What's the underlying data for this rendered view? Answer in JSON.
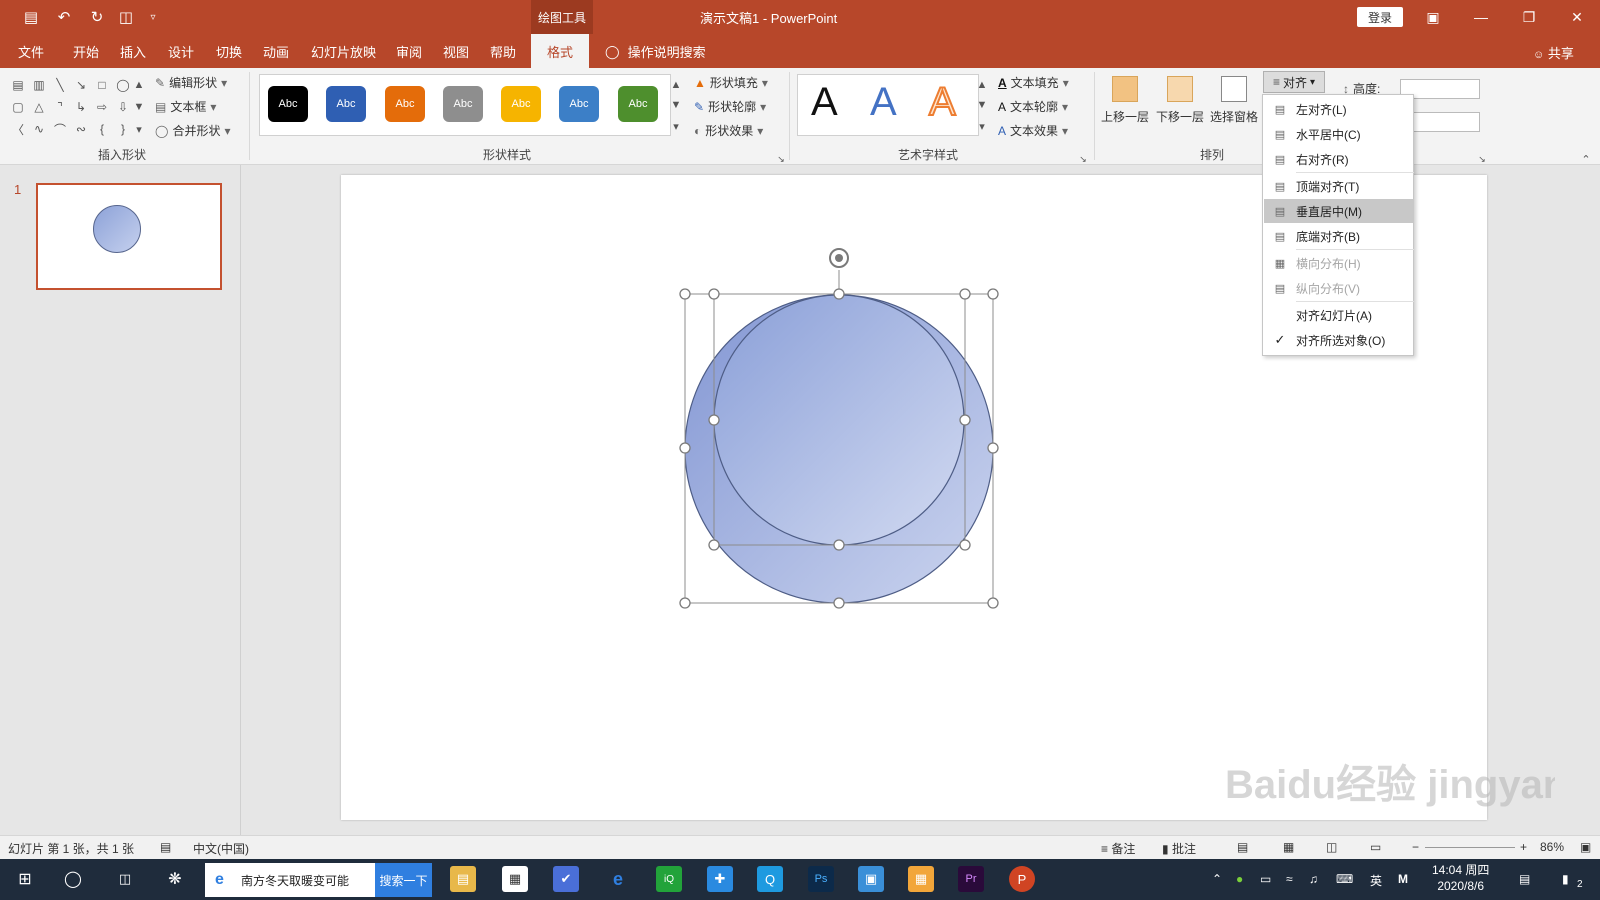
{
  "window": {
    "context_tab": "绘图工具",
    "title": "演示文稿1  -  PowerPoint",
    "login": "登录"
  },
  "quick_access": [
    "save-icon",
    "undo-icon",
    "redo-icon",
    "present-icon",
    "customize-icon"
  ],
  "tabs": [
    "文件",
    "开始",
    "插入",
    "设计",
    "切换",
    "动画",
    "幻灯片放映",
    "审阅",
    "视图",
    "帮助"
  ],
  "active_tab": "格式",
  "search_hint": "操作说明搜索",
  "share": "共享",
  "ribbon": {
    "insert_shapes": {
      "label": "插入形状",
      "edit_shape": "编辑形状",
      "text_box": "文本框",
      "merge_shapes": "合并形状"
    },
    "shape_styles": {
      "label": "形状样式",
      "chips": [
        {
          "text": "Abc",
          "color": "#000000"
        },
        {
          "text": "Abc",
          "color": "#2f5fb3"
        },
        {
          "text": "Abc",
          "color": "#e46c0a"
        },
        {
          "text": "Abc",
          "color": "#8e8e8e"
        },
        {
          "text": "Abc",
          "color": "#f6b400"
        },
        {
          "text": "Abc",
          "color": "#3c7fc7"
        },
        {
          "text": "Abc",
          "color": "#4e8f2d"
        }
      ],
      "fill": "形状填充",
      "outline": "形状轮廓",
      "effects": "形状效果"
    },
    "wordart": {
      "label": "艺术字样式",
      "samples": [
        {
          "text": "A",
          "color": "#111111"
        },
        {
          "text": "A",
          "color": "#4472c4"
        },
        {
          "text": "A",
          "color": "#f4a460"
        }
      ],
      "text_fill": "文本填充",
      "text_outline": "文本轮廓",
      "text_effects": "文本效果"
    },
    "arrange": {
      "label": "排列",
      "bring_forward": "上移一层",
      "send_backward": "下移一层",
      "selection_pane": "选择窗格",
      "align": "对齐"
    },
    "size": {
      "height_label": "高度:"
    }
  },
  "align_menu": {
    "items": [
      {
        "label": "左对齐(L)",
        "icon": "align-left-icon",
        "disabled": false,
        "highlight": false,
        "checked": false
      },
      {
        "label": "水平居中(C)",
        "icon": "align-center-icon",
        "disabled": false,
        "highlight": false,
        "checked": false
      },
      {
        "label": "右对齐(R)",
        "icon": "align-right-icon",
        "disabled": false,
        "highlight": false,
        "checked": false
      },
      {
        "label": "顶端对齐(T)",
        "icon": "align-top-icon",
        "disabled": false,
        "highlight": false,
        "checked": false
      },
      {
        "label": "垂直居中(M)",
        "icon": "align-middle-icon",
        "disabled": false,
        "highlight": true,
        "checked": false
      },
      {
        "label": "底端对齐(B)",
        "icon": "align-bottom-icon",
        "disabled": false,
        "highlight": false,
        "checked": false
      },
      {
        "label": "横向分布(H)",
        "icon": "distribute-horizontal-icon",
        "disabled": true,
        "highlight": false,
        "checked": false
      },
      {
        "label": "纵向分布(V)",
        "icon": "distribute-vertical-icon",
        "disabled": true,
        "highlight": false,
        "checked": false
      },
      {
        "label": "对齐幻灯片(A)",
        "icon": "",
        "disabled": false,
        "highlight": false,
        "checked": false
      },
      {
        "label": "对齐所选对象(O)",
        "icon": "checkmark-icon",
        "disabled": false,
        "highlight": false,
        "checked": true
      }
    ]
  },
  "slides_pane": {
    "slide_number": "1"
  },
  "status": {
    "slide_info": "幻灯片 第 1 张，共 1 张",
    "language": "中文(中国)",
    "notes": "备注",
    "comments": "批注",
    "zoom": "86%"
  },
  "taskbar": {
    "search_text": "南方冬天取暖变可能",
    "search_button": "搜索一下",
    "time": "14:04 周四",
    "date": "2020/8/6",
    "ime": "英",
    "notification_count": "2"
  },
  "watermark": "Baidu经验 jingyan.baidu.com",
  "colors": {
    "accent": "#b7472a",
    "circle_fill": "#9aacdd",
    "selection_handle": "#ffffff"
  }
}
